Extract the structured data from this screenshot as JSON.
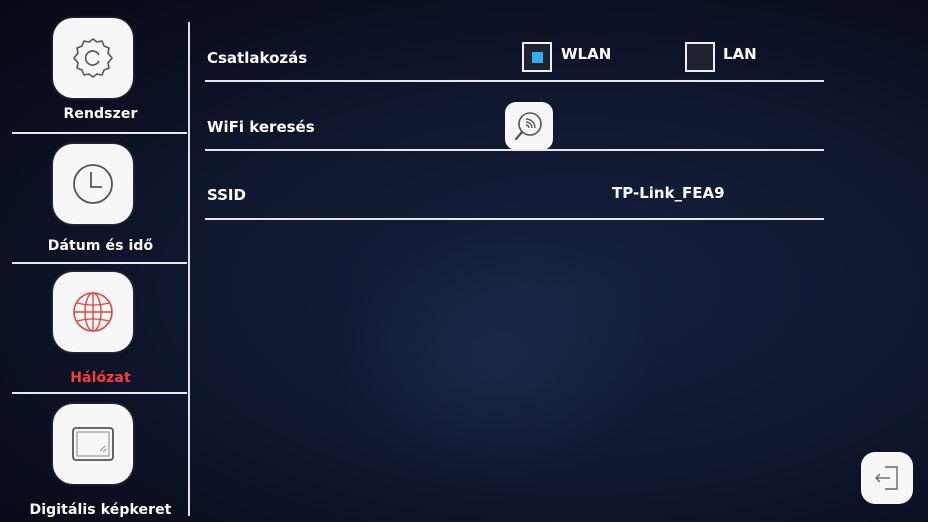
{
  "sidebar": {
    "items": [
      {
        "label": "Rendszer",
        "icon": "gear-icon"
      },
      {
        "label": "Dátum és idő",
        "icon": "clock-icon"
      },
      {
        "label": "Hálózat",
        "icon": "globe-icon",
        "active": true
      },
      {
        "label": "Digitális képkeret",
        "icon": "photo-frame-icon"
      }
    ]
  },
  "settings": {
    "connection": {
      "label": "Csatlakozás",
      "options": [
        {
          "label": "WLAN",
          "checked": true
        },
        {
          "label": "LAN",
          "checked": false
        }
      ]
    },
    "wifi_search": {
      "label": "WiFi keresés",
      "icon": "wifi-search-icon"
    },
    "ssid": {
      "label": "SSID",
      "value": "TP-Link_FEA9"
    }
  },
  "back_button": {
    "icon": "back-exit-icon"
  },
  "colors": {
    "active_label": "#ff3b3b",
    "checkbox_fill": "#2ab4ee",
    "icon_outline": "#555555",
    "globe_red": "#e0463f"
  }
}
